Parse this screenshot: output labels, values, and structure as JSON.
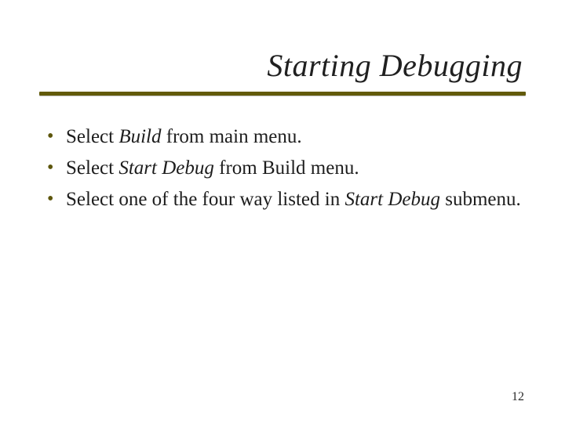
{
  "accent_color": "#625a0a",
  "title": "Starting Debugging",
  "bullets": {
    "b0": {
      "pre": "Select ",
      "it": "Build",
      "post": " from main menu."
    },
    "b1": {
      "pre": "Select ",
      "it": "Start Debug",
      "post": " from Build menu."
    },
    "b2": {
      "pre": "Select one of the four way listed in ",
      "it": "Start Debug",
      "post": " submenu."
    }
  },
  "page_number": "12"
}
